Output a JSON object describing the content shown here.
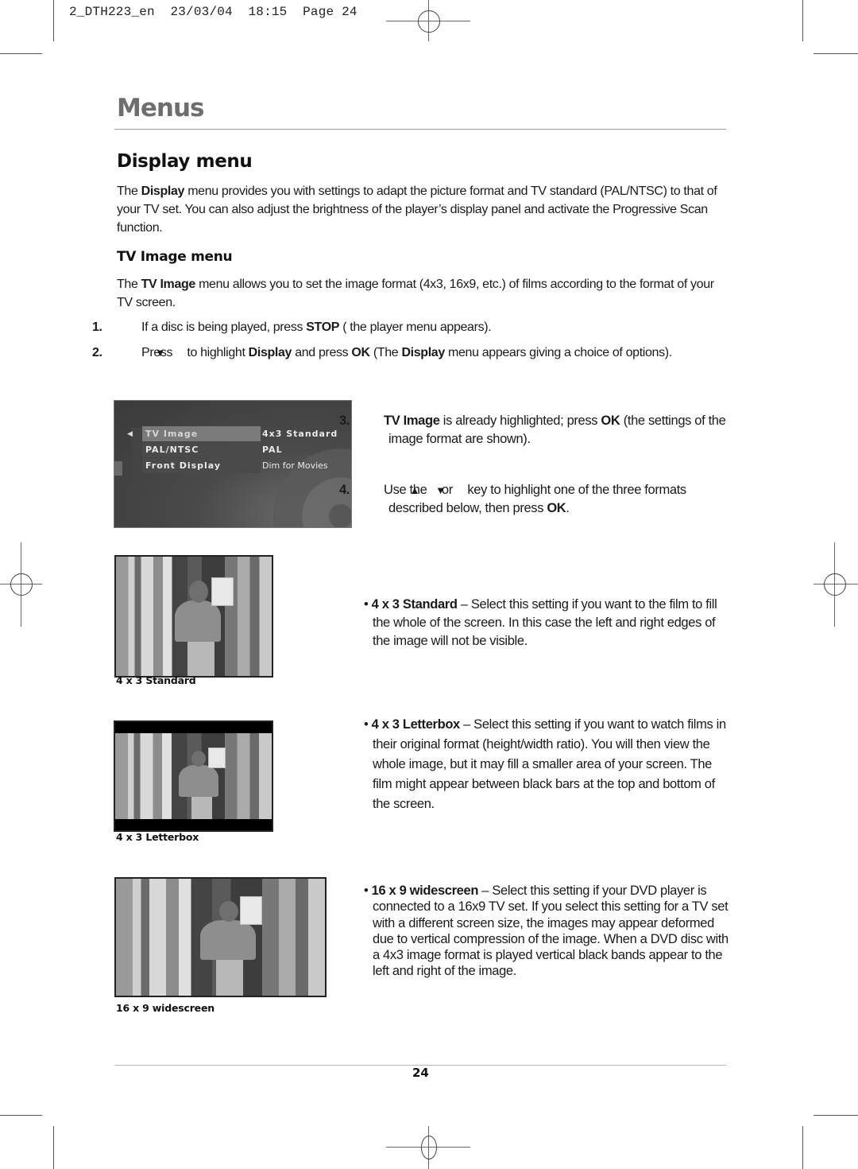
{
  "slug": {
    "file": "2_DTH223_en",
    "date": "23/03/04",
    "time": "18:15",
    "page_label": "Page 24"
  },
  "section_title": "Menus",
  "display_menu": {
    "heading": "Display menu",
    "intro": {
      "pre": "The ",
      "bold": "Display",
      "post": " menu provides you with settings to adapt the picture format and TV standard (PAL/NTSC) to that of your TV set. You can also adjust the brightness of the player’s display panel and activate the Progressive Scan function."
    }
  },
  "tv_image_menu": {
    "heading": "TV Image menu",
    "intro": {
      "pre": "The ",
      "bold": "TV Image",
      "post": " menu allows you to set the image format (4x3, 16x9, etc.) of films according to the format of your TV screen."
    },
    "steps": [
      {
        "num": "1.",
        "t1": "If a disc is being played, press ",
        "b1": "STOP",
        "t2": " ( the player menu appears)."
      },
      {
        "num": "2.",
        "t1": "Press ",
        "key": "down-arrow",
        "t2": " to highlight ",
        "b1": "Display",
        "t3": " and press ",
        "b2": "OK",
        "t4": " (The ",
        "b3": "Display",
        "t5": " menu appears giving a choice of options)."
      },
      {
        "num": "3.",
        "b1": "TV Image",
        "t1": " is already highlighted; press ",
        "b2": "OK",
        "t2": " (the settings of the image format are shown)."
      },
      {
        "num": "4.",
        "t1": "Use the ",
        "key1": "up-arrow",
        "t2": " or ",
        "key2": "down-arrow",
        "t3": " key to highlight one of the three formats described below, then press ",
        "b1": "OK",
        "t4": "."
      }
    ]
  },
  "osd_menu": {
    "items": [
      {
        "label": "TV Image",
        "value": "4x3 Standard",
        "selected": true
      },
      {
        "label": "PAL/NTSC",
        "value": "PAL",
        "selected": false
      },
      {
        "label": "Front Display",
        "value": "Dim for Movies",
        "selected": false
      }
    ]
  },
  "formats": [
    {
      "name": "4 x 3 Standard",
      "caption": "4 x 3 Standard",
      "desc": " – Select this setting if you want to the film to fill the whole of the screen. In this case the left and right edges of the image will not be visible."
    },
    {
      "name": "4 x 3 Letterbox",
      "caption": "4 x 3 Letterbox",
      "desc": " – Select this setting if you want to watch films in their original format (height/width ratio). You will then view the whole image, but it may fill a smaller area of your screen. The film might appear between black bars at the top and bottom of the screen."
    },
    {
      "name": "16 x 9 widescreen",
      "caption": "16 x 9 widescreen",
      "desc": " – Select this setting if your DVD player is connected to a 16x9 TV set. If you select this setting for a TV set with a different screen size, the images may appear deformed due to vertical compression of the image. When a DVD disc with a 4x3 image format is played vertical black bands appear to the left and right of the image."
    }
  ],
  "page_number": "24",
  "glyphs": {
    "down_arrow": "▼",
    "up_arrow": "▲",
    "bullet": "•",
    "osd_left": "◀",
    "osd_right": "▶"
  }
}
